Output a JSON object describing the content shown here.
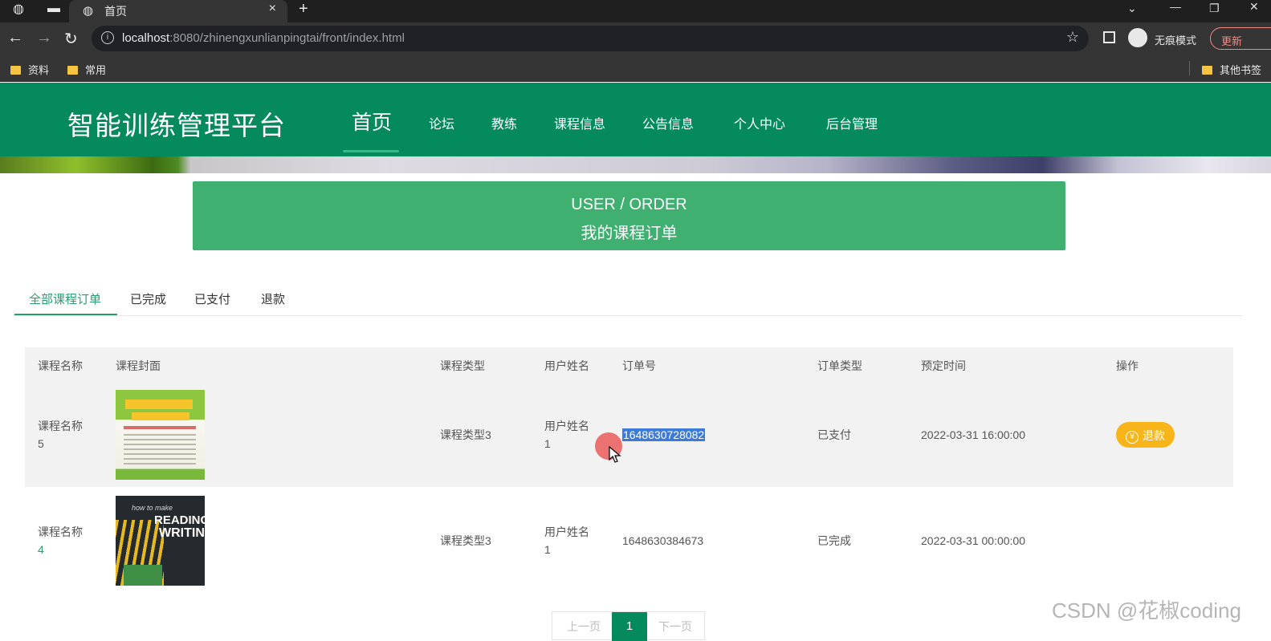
{
  "browser": {
    "tab_title": "首页",
    "url_host": "localhost",
    "url_path": ":8080/zhinengxunlianpingtai/front/index.html",
    "incognito_label": "无痕模式",
    "update_label": "更新",
    "bookmarks": [
      "资料",
      "常用"
    ],
    "other_bookmarks": "其他书签"
  },
  "site": {
    "brand": "智能训练管理平台",
    "nav": [
      "首页",
      "论坛",
      "教练",
      "课程信息",
      "公告信息",
      "个人中心",
      "后台管理"
    ],
    "active_nav": "首页"
  },
  "order_hero": {
    "title_en": "USER / ORDER",
    "title_zh": "我的课程订单"
  },
  "tabs": [
    "全部课程订单",
    "已完成",
    "已支付",
    "退款"
  ],
  "active_tab": "全部课程订单",
  "table": {
    "columns": [
      "课程名称",
      "课程封面",
      "课程类型",
      "用户姓名",
      "订单号",
      "订单类型",
      "预定时间",
      "操作"
    ],
    "rows": [
      {
        "name_line1": "课程名称",
        "name_line2": "5",
        "type": "课程类型3",
        "user_line1": "用户姓名",
        "user_line2": "1",
        "order_no": "1648630728082",
        "order_type": "已支付",
        "time": "2022-03-31 16:00:00",
        "action": "退款",
        "cover_text": [
          "疯狂英语",
          "欢迎您"
        ]
      },
      {
        "name_line1": "课程名称",
        "name_line2": "4",
        "type": "课程类型3",
        "user_line1": "用户姓名",
        "user_line2": "1",
        "order_no": "1648630384673",
        "order_type": "已完成",
        "time": "2022-03-31 00:00:00",
        "action": "",
        "cover_text": [
          "how to make",
          "READING",
          "WRITING"
        ]
      }
    ]
  },
  "pagination": {
    "prev": "上一页",
    "current": "1",
    "next": "下一页"
  },
  "watermark": "CSDN @花椒coding",
  "colors": {
    "header_green": "#058a5e",
    "hero_green": "#3fb070",
    "tab_active": "#2a9d6f",
    "refund_button": "#f7b51a"
  }
}
